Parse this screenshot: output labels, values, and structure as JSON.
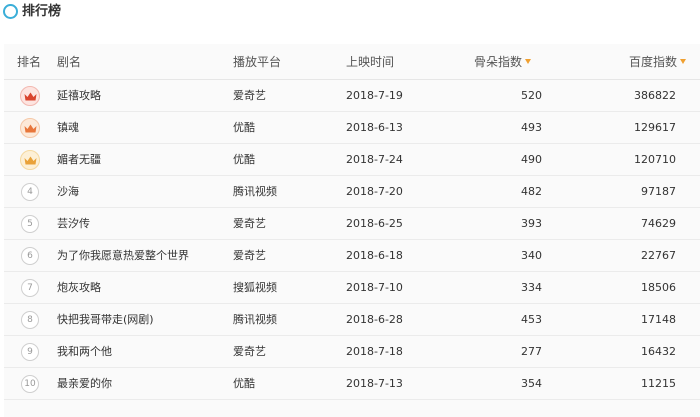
{
  "header": {
    "title": "排行榜",
    "accent": "#3aaed8"
  },
  "table": {
    "columns": {
      "rank": "排名",
      "name": "剧名",
      "platform": "播放平台",
      "date": "上映时间",
      "maoyan": "骨朵指数",
      "baidu": "百度指数"
    },
    "sort_icon_color": "#f0a030",
    "rows": [
      {
        "rank": "1",
        "badge": "crown-gold",
        "name": "延禧攻略",
        "platform": "爱奇艺",
        "date": "2018-7-19",
        "maoyan": "520",
        "baidu": "386822"
      },
      {
        "rank": "2",
        "badge": "crown-silver",
        "name": "镇魂",
        "platform": "优酷",
        "date": "2018-6-13",
        "maoyan": "493",
        "baidu": "129617"
      },
      {
        "rank": "3",
        "badge": "crown-bronze",
        "name": "媚者无疆",
        "platform": "优酷",
        "date": "2018-7-24",
        "maoyan": "490",
        "baidu": "120710"
      },
      {
        "rank": "4",
        "badge": "number",
        "name": "沙海",
        "platform": "腾讯视频",
        "date": "2018-7-20",
        "maoyan": "482",
        "baidu": "97187"
      },
      {
        "rank": "5",
        "badge": "number",
        "name": "芸汐传",
        "platform": "爱奇艺",
        "date": "2018-6-25",
        "maoyan": "393",
        "baidu": "74629"
      },
      {
        "rank": "6",
        "badge": "number",
        "name": "为了你我愿意热爱整个世界",
        "platform": "爱奇艺",
        "date": "2018-6-18",
        "maoyan": "340",
        "baidu": "22767"
      },
      {
        "rank": "7",
        "badge": "number",
        "name": "炮灰攻略",
        "platform": "搜狐视频",
        "date": "2018-7-10",
        "maoyan": "334",
        "baidu": "18506"
      },
      {
        "rank": "8",
        "badge": "number",
        "name": "快把我哥带走(网剧)",
        "platform": "腾讯视频",
        "date": "2018-6-28",
        "maoyan": "453",
        "baidu": "17148"
      },
      {
        "rank": "9",
        "badge": "number",
        "name": "我和两个他",
        "platform": "爱奇艺",
        "date": "2018-7-18",
        "maoyan": "277",
        "baidu": "16432"
      },
      {
        "rank": "10",
        "badge": "number",
        "name": "最亲爱的你",
        "platform": "优酷",
        "date": "2018-7-13",
        "maoyan": "354",
        "baidu": "11215"
      }
    ]
  }
}
